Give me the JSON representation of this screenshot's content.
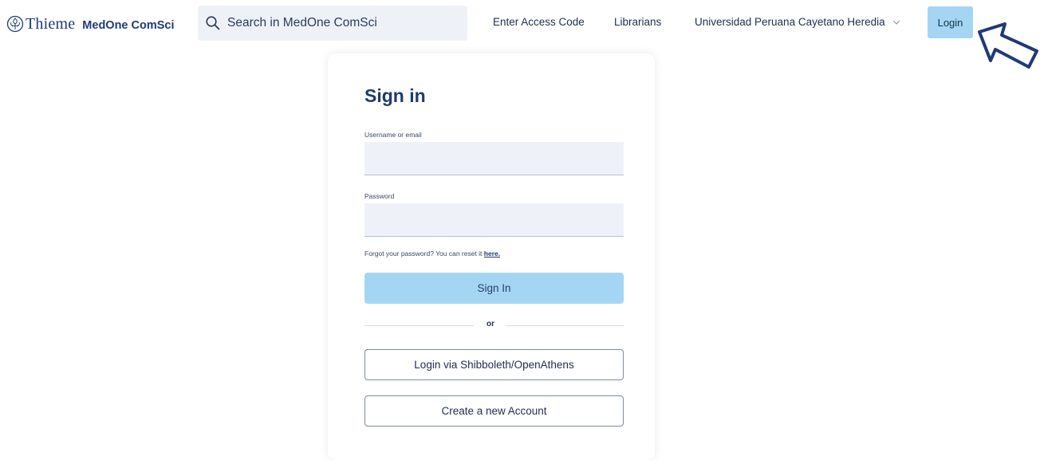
{
  "header": {
    "brand": {
      "name": "Thieme",
      "product": "MedOne ComSci",
      "emblem_icon": "thieme-emblem-icon"
    },
    "search": {
      "placeholder": "Search in MedOne ComSci",
      "icon": "search-icon"
    },
    "nav": {
      "access_code": "Enter Access Code",
      "librarians": "Librarians",
      "institution": "Universidad Peruana Cayetano Heredia",
      "institution_icon": "chevron-down-icon"
    },
    "login_label": "Login",
    "pointer_icon": "hand-pointer-arrow-icon"
  },
  "signin": {
    "title": "Sign in",
    "username_label": "Username or email",
    "username_value": "",
    "password_label": "Password",
    "password_value": "",
    "forgot_text": "Forgot your password? You can reset it ",
    "forgot_link": "here.",
    "signin_button": "Sign In",
    "divider_text": "or",
    "shibboleth_button": "Login via Shibboleth/OpenAthens",
    "create_account_button": "Create a new Account"
  },
  "colors": {
    "brand_navy": "#1d3b78",
    "accent_light_blue": "#a4d6f4",
    "field_background": "#eef2f8"
  }
}
